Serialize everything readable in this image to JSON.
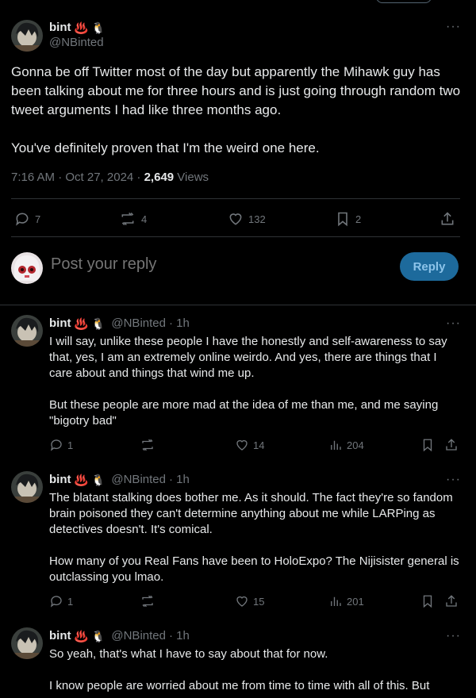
{
  "main_tweet": {
    "author_name": "bint",
    "author_emojis": [
      "♨️",
      "🐧"
    ],
    "author_handle": "@NBinted",
    "paragraphs": [
      "Gonna be off Twitter most of the day but apparently the Mihawk guy has been talking about me for three hours and is just going through random two tweet arguments I had like three months ago.",
      "You've definitely proven that I'm the weird one here."
    ],
    "time": "7:16 AM · Oct 27, 2024 · ",
    "views_count": "2,649",
    "views_label": " Views",
    "reply_count": "7",
    "retweet_count": "4",
    "like_count": "132",
    "bookmark_count": "2",
    "more_icon": "more-icon"
  },
  "reply_box": {
    "placeholder": "Post your reply",
    "button_label": "Reply"
  },
  "replies": [
    {
      "name": "bint",
      "emojis": [
        "♨️",
        "🐧"
      ],
      "handle": "@NBinted",
      "time": "· 1h",
      "paragraphs": [
        "I will say, unlike these people I have the honestly and self-awareness to say that, yes, I am an extremely online weirdo. And yes, there are things that I care about and things that wind me up.",
        "But these people are more mad at the idea of me than me, and me saying \"bigotry bad\""
      ],
      "reply_count": "1",
      "retweet_count": "",
      "like_count": "14",
      "views_count": "204"
    },
    {
      "name": "bint",
      "emojis": [
        "♨️",
        "🐧"
      ],
      "handle": "@NBinted",
      "time": "· 1h",
      "paragraphs": [
        "The blatant stalking does bother me. As it should. The fact they're so fandom brain poisoned they can't determine anything about me while LARPing as detectives doesn't. It's comical.",
        "How many of you Real Fans have been to HoloExpo? The Nijisister general is outclassing you lmao."
      ],
      "reply_count": "1",
      "retweet_count": "",
      "like_count": "15",
      "views_count": "201"
    },
    {
      "name": "bint",
      "emojis": [
        "♨️",
        "🐧"
      ],
      "handle": "@NBinted",
      "time": "· 1h",
      "paragraphs": [
        "So yeah, that's what I have to say about that for now.",
        "I know people are worried about me from time to time with all of this. But"
      ]
    }
  ],
  "colors": {
    "background": "#000000",
    "text": "#e7e9ea",
    "secondary": "#71767b",
    "divider": "#2f3336",
    "reply_button": "#1d6a9c"
  }
}
